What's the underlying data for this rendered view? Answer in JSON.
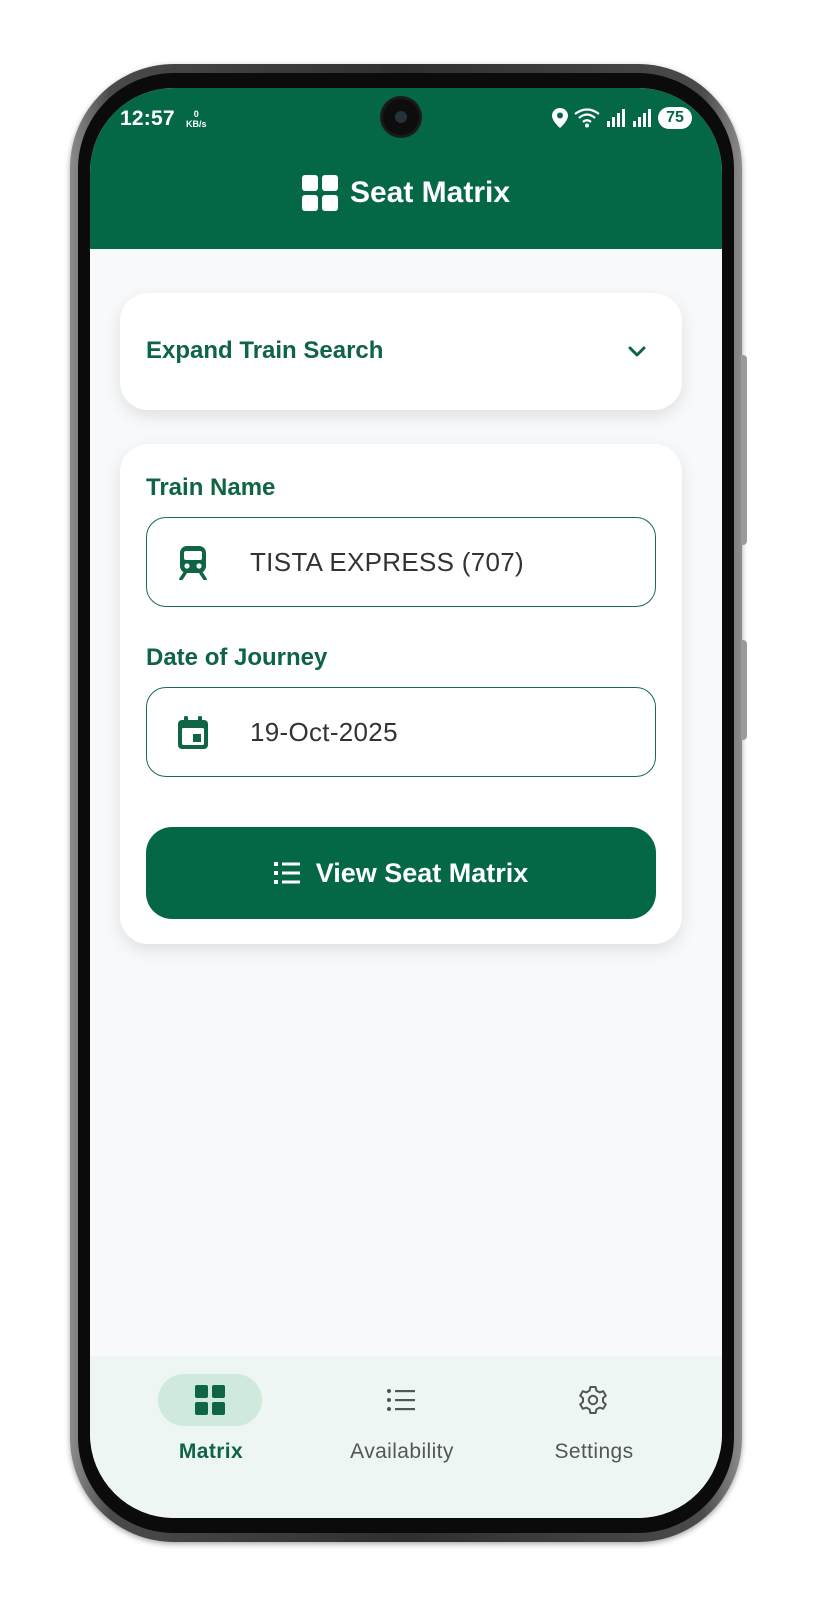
{
  "status_bar": {
    "time": "12:57",
    "net_speed_value": "0",
    "net_speed_unit": "KB/s",
    "battery": "75"
  },
  "app_bar": {
    "title": "Seat Matrix",
    "icon": "grid-icon"
  },
  "expand_section": {
    "label": "Expand Train Search",
    "icon": "chevron-down-icon"
  },
  "form": {
    "train_name_label": "Train Name",
    "train_name_value": "TISTA EXPRESS (707)",
    "train_icon": "train-icon",
    "date_label": "Date of Journey",
    "date_value": "19-Oct-2025",
    "date_icon": "calendar-icon",
    "submit_label": "View Seat Matrix",
    "submit_icon": "list-icon"
  },
  "bottom_nav": {
    "items": [
      {
        "label": "Matrix",
        "icon": "grid-icon",
        "active": true
      },
      {
        "label": "Availability",
        "icon": "list-icon",
        "active": false
      },
      {
        "label": "Settings",
        "icon": "gear-icon",
        "active": false
      }
    ]
  },
  "colors": {
    "primary": "#046847",
    "label_green": "#0f6444",
    "background": "#f7f9fa",
    "nav_background": "#eef6f3",
    "active_pill": "#cfe9dc"
  }
}
